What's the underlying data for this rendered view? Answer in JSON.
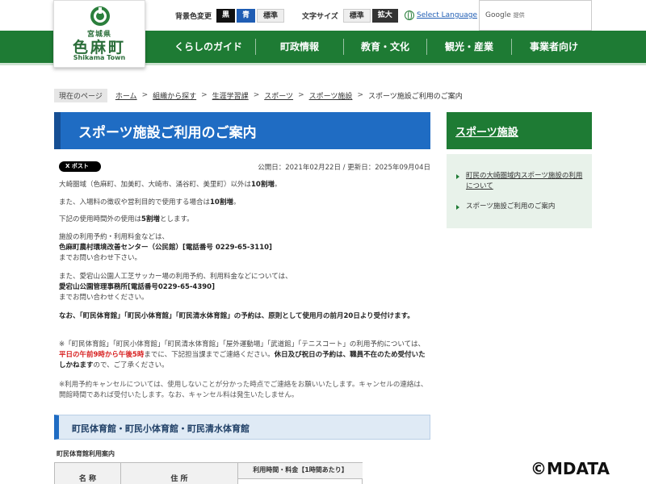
{
  "logo": {
    "pref": "宮城県",
    "town": "色麻町",
    "en": "Shikama Town"
  },
  "utility": {
    "bg_label": "背景色変更",
    "bg_black": "黒",
    "bg_blue": "青",
    "bg_std": "標準",
    "font_label": "文字サイズ",
    "font_std": "標準",
    "font_big": "拡大",
    "select_language": "Select Language",
    "google_label": "Google",
    "google_sub": "提供"
  },
  "nav": [
    "くらしのガイド",
    "町政情報",
    "教育・文化",
    "観光・産業",
    "事業者向け"
  ],
  "breadcrumb": {
    "here": "現在のページ",
    "links": [
      "ホーム",
      "組織から探す",
      "生涯学習課",
      "スポーツ",
      "スポーツ施設"
    ],
    "current": "スポーツ施設ご利用のご案内"
  },
  "page": {
    "title": "スポーツ施設ご利用のご案内",
    "x_post": "X ポスト",
    "dates": "公開日：2021年02月22日 / 更新日：2025年09月04日",
    "p1a": "大崎圏域（色麻町、加美町、大崎市、涌谷町、美里町）以外は",
    "p1b": "10割増",
    "p1c": "。",
    "p2a": "また、入場料の徴収や営利目的で使用する場合は",
    "p2b": "10割増",
    "p2c": "。",
    "p3a": "下記の使用時間外の使用は",
    "p3b": "5割増",
    "p3c": "とします。",
    "p4a": "施設の利用予約・利用料金などは、",
    "p4b": "色麻町農村環境改善センター（公民館）[電話番号 0229-65-3110]",
    "p4c": "までお問い合わせ下さい。",
    "p5a": "また、愛宕山公園人工芝サッカー場の利用予約、利用料金などについては、",
    "p5b": "愛宕山公園管理事務所[電話番号0229-65-4390]",
    "p5c": "までお問い合わせください。",
    "p6": "なお、「町民体育館」「町民小体育館」「町民清水体育館」の予約は、原則として使用月の前月20日より受付けます。",
    "p7a": "※「町民体育館」「町民小体育館」「町民清水体育館」「屋外運動場」「武道館」「テニスコート」",
    "p7b": "の利用予約については、",
    "p7c": "平日の午前9時から午後5時",
    "p7d": "までに、下記担当課までご連絡ください。",
    "p7e": "休日及び祝日の予約は、職員不在のため受付いたしかねます",
    "p7f": "ので、ご了承ください。",
    "p8": "※利用予約キャンセルについては、使用しないことが分かった時点でご連絡をお願いいたします。キャンセルの連絡は、開館時間であれば受付いたします。なお、キャンセル料は発生いたしません。",
    "section_title": "町民体育館・町民小体育館・町民清水体育館",
    "table_caption": "町民体育館利用案内",
    "th_name": "名 称",
    "th_address": "住 所",
    "th_fee": "利用時間・料金【1時間あたり】"
  },
  "sidebar": {
    "title": "スポーツ施設",
    "items": [
      "町民の大崎圏域内スポーツ施設の利用について",
      "スポーツ施設ご利用のご案内"
    ]
  },
  "watermark": "©MDATA",
  "colors": {
    "green": "#1e7b34",
    "blue": "#1f6cc3",
    "red": "#d71d1d"
  }
}
